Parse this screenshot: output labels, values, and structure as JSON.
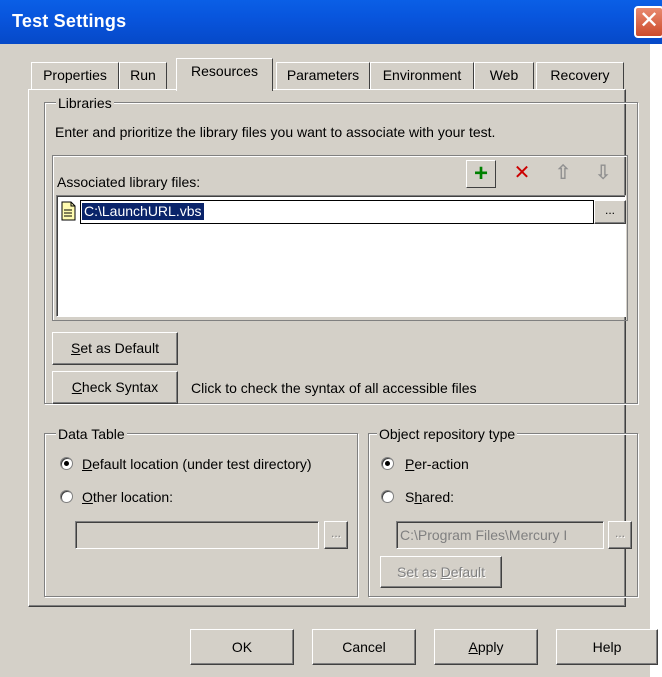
{
  "window": {
    "title": "Test Settings",
    "close_glyph": "✕"
  },
  "tabs": [
    {
      "label": "Properties"
    },
    {
      "label": "Run"
    },
    {
      "label": "Resources",
      "active": true
    },
    {
      "label": "Parameters"
    },
    {
      "label": "Environment"
    },
    {
      "label": "Web"
    },
    {
      "label": "Recovery"
    }
  ],
  "libraries": {
    "group_label": "Libraries",
    "description": "Enter and prioritize the library files you want to associate with your test.",
    "list_label": "Associated library files:",
    "toolbar": {
      "add_glyph": "+",
      "remove_glyph": "✕",
      "up_glyph": "⇧",
      "down_glyph": "⇩"
    },
    "files": [
      {
        "path": "C:\\LaunchURL.vbs",
        "selected": true
      }
    ],
    "browse_glyph": "...",
    "set_default": {
      "mnemonic": "S",
      "rest": "et as Default"
    },
    "check_syntax": {
      "mnemonic": "C",
      "rest": "heck Syntax"
    },
    "check_syntax_hint": "Click to check the syntax of all accessible files"
  },
  "data_table": {
    "group_label": "Data Table",
    "default_option": {
      "mnemonic": "D",
      "rest": "efault location (under test directory)",
      "checked": true
    },
    "other_option": {
      "mnemonic": "O",
      "rest": "ther location:",
      "checked": false
    },
    "other_path_value": "",
    "browse_glyph": "..."
  },
  "object_repository": {
    "group_label": "Object repository type",
    "per_action": {
      "mnemonic": "P",
      "rest": "er-action",
      "checked": true
    },
    "shared": {
      "pre": "S",
      "mnemonic": "h",
      "rest": "ared:",
      "checked": false
    },
    "shared_path_value": "C:\\Program Files\\Mercury I",
    "browse_glyph": "...",
    "set_default": {
      "pre": "Set as ",
      "mnemonic": "D",
      "rest": "efault"
    }
  },
  "footer": {
    "ok": "OK",
    "cancel": "Cancel",
    "apply": {
      "mnemonic": "A",
      "rest": "pply"
    },
    "help": "Help"
  },
  "colors": {
    "titlebar": "#0855dd",
    "dialog_bg": "#d4d0c8",
    "selection": "#0a246a",
    "add_green": "#008000",
    "remove_red": "#cc0000"
  }
}
